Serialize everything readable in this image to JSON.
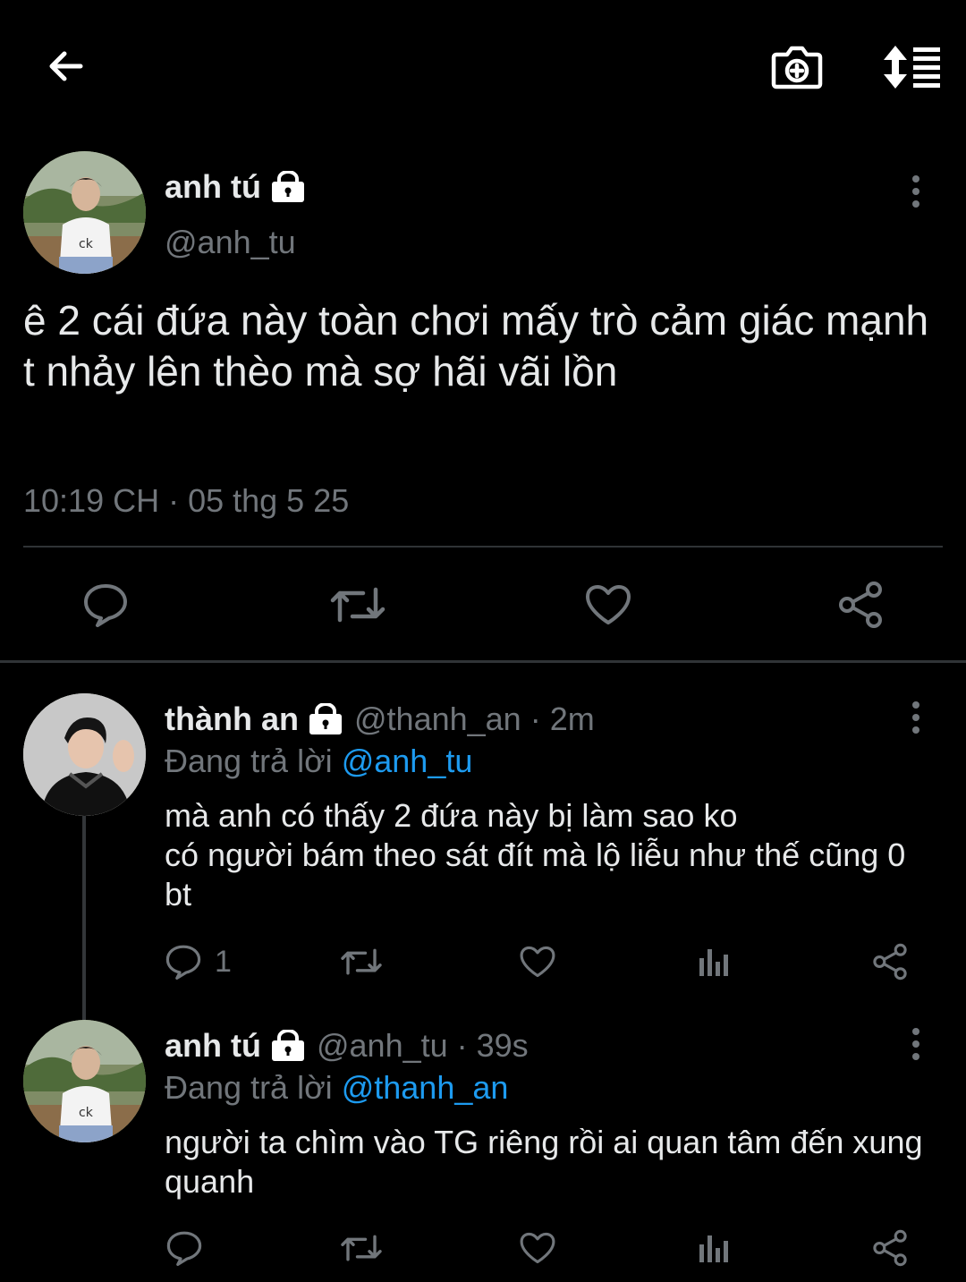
{
  "colors": {
    "background": "#000000",
    "text_primary": "#e7e9ea",
    "text_secondary": "#71767b",
    "link": "#1d9bf0",
    "divider": "#2f3336"
  },
  "topbar": {
    "icons": [
      "back-arrow-icon",
      "camera-add-icon",
      "sort-list-icon"
    ]
  },
  "main_tweet": {
    "author_name": "anh tú",
    "handle": "@anh_tu",
    "text": "ê 2 cái đứa này toàn chơi mấy trò cảm giác mạnh\nt nhảy lên thèo mà sợ hãi vãi lồn",
    "timestamp": "10:19 CH · 05 thg 5 25",
    "actions": [
      "reply-icon",
      "retweet-icon",
      "like-icon",
      "share-icon"
    ]
  },
  "replies": [
    {
      "author_name": "thành an",
      "meta": "@thanh_an · 2m",
      "replying_to_label": "Đang trả lời",
      "replying_to_handle": "@anh_tu",
      "text": "mà anh có thấy 2 đứa này bị làm sao ko\ncó người bám theo sát đít mà lộ liễu như thế cũng 0 bt",
      "reply_count": "1"
    },
    {
      "author_name": "anh tú",
      "meta": "@anh_tu · 39s",
      "replying_to_label": "Đang trả lời",
      "replying_to_handle": "@thanh_an",
      "text": "người ta chìm vào TG riêng rồi ai quan tâm đến xung quanh",
      "reply_count": ""
    }
  ]
}
